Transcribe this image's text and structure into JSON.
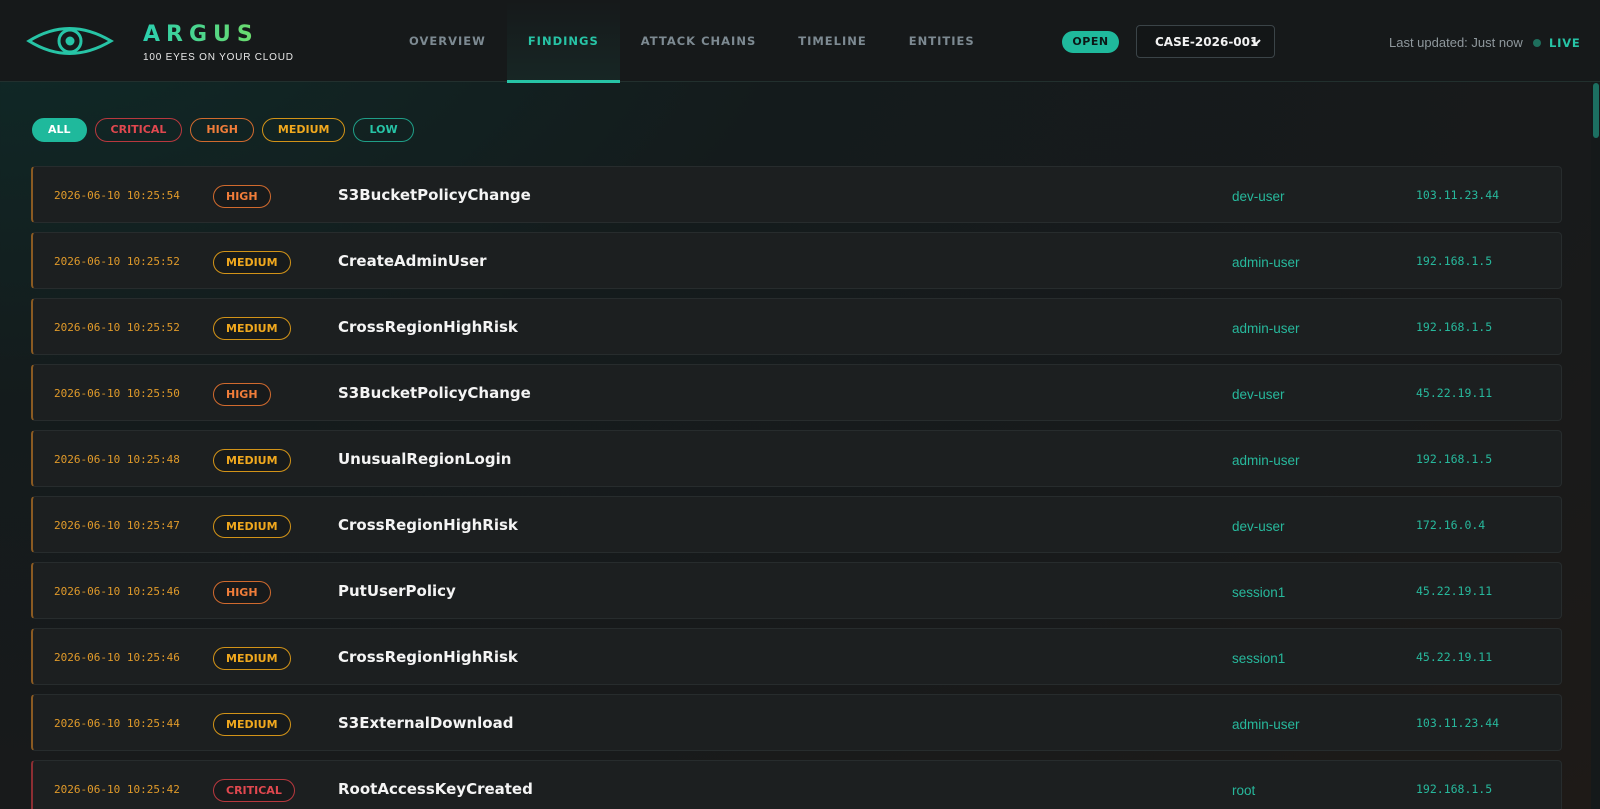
{
  "brand": {
    "title": "ARGUS",
    "subtitle": "100 EYES ON YOUR CLOUD",
    "logo_icon": "eye-icon",
    "accent": "#27c4a6"
  },
  "nav": {
    "tabs": [
      {
        "label": "OVERVIEW",
        "active": false
      },
      {
        "label": "FINDINGS",
        "active": true
      },
      {
        "label": "ATTACK CHAINS",
        "active": false
      },
      {
        "label": "TIMELINE",
        "active": false
      },
      {
        "label": "ENTITIES",
        "active": false
      }
    ]
  },
  "case": {
    "status": "OPEN",
    "selected": "CASE-2026-001",
    "chevron_icon": "chevron-down-icon"
  },
  "live": {
    "last_updated": "Last updated: Just now",
    "label": "LIVE"
  },
  "filters": [
    {
      "label": "ALL",
      "key": "all",
      "active": true
    },
    {
      "label": "CRITICAL",
      "key": "critical",
      "active": false
    },
    {
      "label": "HIGH",
      "key": "high",
      "active": false
    },
    {
      "label": "MEDIUM",
      "key": "medium",
      "active": false
    },
    {
      "label": "LOW",
      "key": "low",
      "active": false
    }
  ],
  "severity_colors": {
    "critical": "#e0484f",
    "high": "#f07d3a",
    "medium": "#f0a81e",
    "low": "#27c4a6"
  },
  "findings": [
    {
      "timestamp": "2026-06-10 10:25:54",
      "severity": "HIGH",
      "event": "S3BucketPolicyChange",
      "user": "dev-user",
      "ip": "103.11.23.44"
    },
    {
      "timestamp": "2026-06-10 10:25:52",
      "severity": "MEDIUM",
      "event": "CreateAdminUser",
      "user": "admin-user",
      "ip": "192.168.1.5"
    },
    {
      "timestamp": "2026-06-10 10:25:52",
      "severity": "MEDIUM",
      "event": "CrossRegionHighRisk",
      "user": "admin-user",
      "ip": "192.168.1.5"
    },
    {
      "timestamp": "2026-06-10 10:25:50",
      "severity": "HIGH",
      "event": "S3BucketPolicyChange",
      "user": "dev-user",
      "ip": "45.22.19.11"
    },
    {
      "timestamp": "2026-06-10 10:25:48",
      "severity": "MEDIUM",
      "event": "UnusualRegionLogin",
      "user": "admin-user",
      "ip": "192.168.1.5"
    },
    {
      "timestamp": "2026-06-10 10:25:47",
      "severity": "MEDIUM",
      "event": "CrossRegionHighRisk",
      "user": "dev-user",
      "ip": "172.16.0.4"
    },
    {
      "timestamp": "2026-06-10 10:25:46",
      "severity": "HIGH",
      "event": "PutUserPolicy",
      "user": "session1",
      "ip": "45.22.19.11"
    },
    {
      "timestamp": "2026-06-10 10:25:46",
      "severity": "MEDIUM",
      "event": "CrossRegionHighRisk",
      "user": "session1",
      "ip": "45.22.19.11"
    },
    {
      "timestamp": "2026-06-10 10:25:44",
      "severity": "MEDIUM",
      "event": "S3ExternalDownload",
      "user": "admin-user",
      "ip": "103.11.23.44"
    },
    {
      "timestamp": "2026-06-10 10:25:42",
      "severity": "CRITICAL",
      "event": "RootAccessKeyCreated",
      "user": "root",
      "ip": "192.168.1.5"
    }
  ]
}
